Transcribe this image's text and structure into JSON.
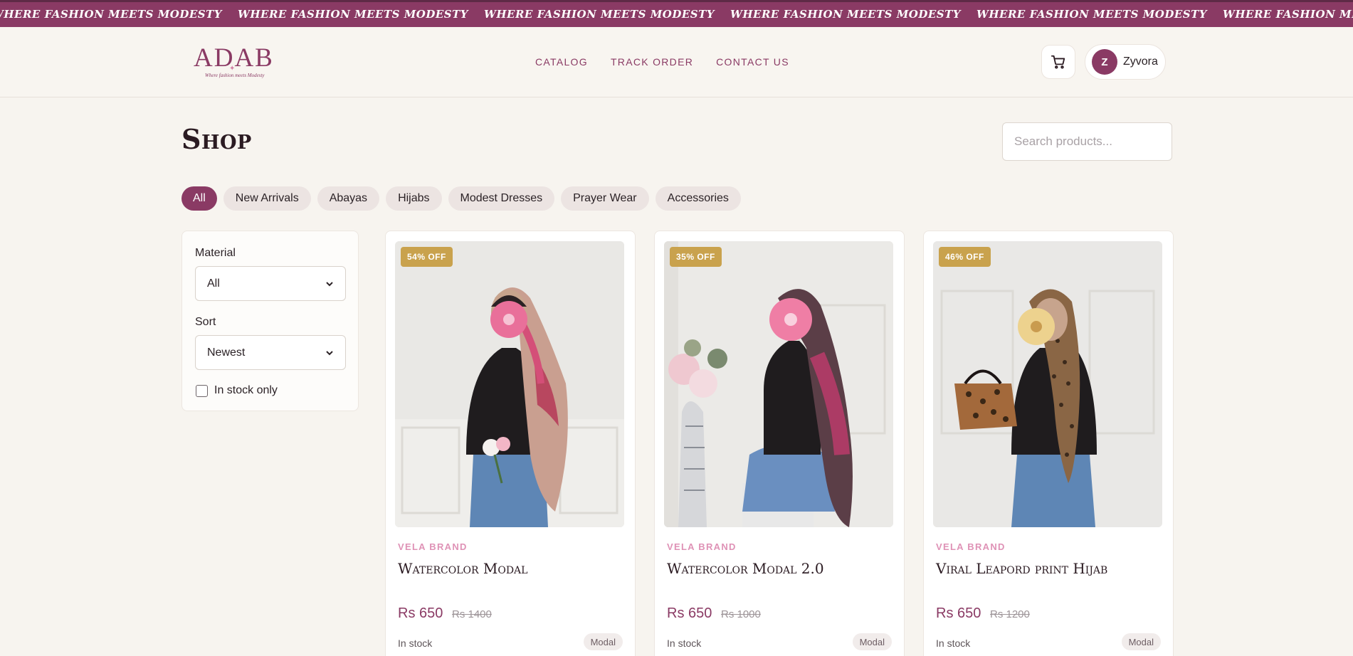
{
  "marquee": {
    "items": [
      "WHERE FASHION MEETS MODESTY",
      "WHERE FASHION MEETS MODESTY",
      "WHERE FASHION MEETS MODESTY",
      "WHERE FASHION MEETS MODESTY",
      "WHERE FASHION MEETS MODESTY",
      "WHERE FASHION MEETS MODESTY"
    ]
  },
  "header": {
    "logo": {
      "wordmark": "ADAB",
      "tagline": "Where fashion meets Modesty"
    },
    "nav": [
      "CATALOG",
      "TRACK ORDER",
      "CONTACT US"
    ],
    "cart_icon": "cart-icon",
    "user": {
      "initial": "Z",
      "name": "Zyvora"
    }
  },
  "shop": {
    "title": "Shop",
    "search_placeholder": "Search products..."
  },
  "categories": {
    "items": [
      "All",
      "New Arrivals",
      "Abayas",
      "Hijabs",
      "Modest Dresses",
      "Prayer Wear",
      "Accessories"
    ],
    "active": "All"
  },
  "filters": {
    "material_label": "Material",
    "material_value": "All",
    "sort_label": "Sort",
    "sort_value": "Newest",
    "in_stock_label": "In stock only",
    "in_stock_checked": false
  },
  "products": [
    {
      "badge": "54% OFF",
      "brand": "VELA BRAND",
      "name": "Watercolor Modal",
      "price": "Rs 650",
      "old_price": "Rs 1400",
      "stock": "In stock",
      "material": "Modal"
    },
    {
      "badge": "35% OFF",
      "brand": "VELA BRAND",
      "name": "Watercolor Modal 2.0",
      "price": "Rs 650",
      "old_price": "Rs 1000",
      "stock": "In stock",
      "material": "Modal"
    },
    {
      "badge": "46% OFF",
      "brand": "VELA BRAND",
      "name": "Viral Leapord print Hijab",
      "price": "Rs 650",
      "old_price": "Rs 1200",
      "stock": "In stock",
      "material": "Modal"
    }
  ],
  "colors": {
    "brand": "#8a3a64",
    "background": "#f7f4ef",
    "badge": "#c9a24d",
    "brand_label": "#df92b6"
  }
}
